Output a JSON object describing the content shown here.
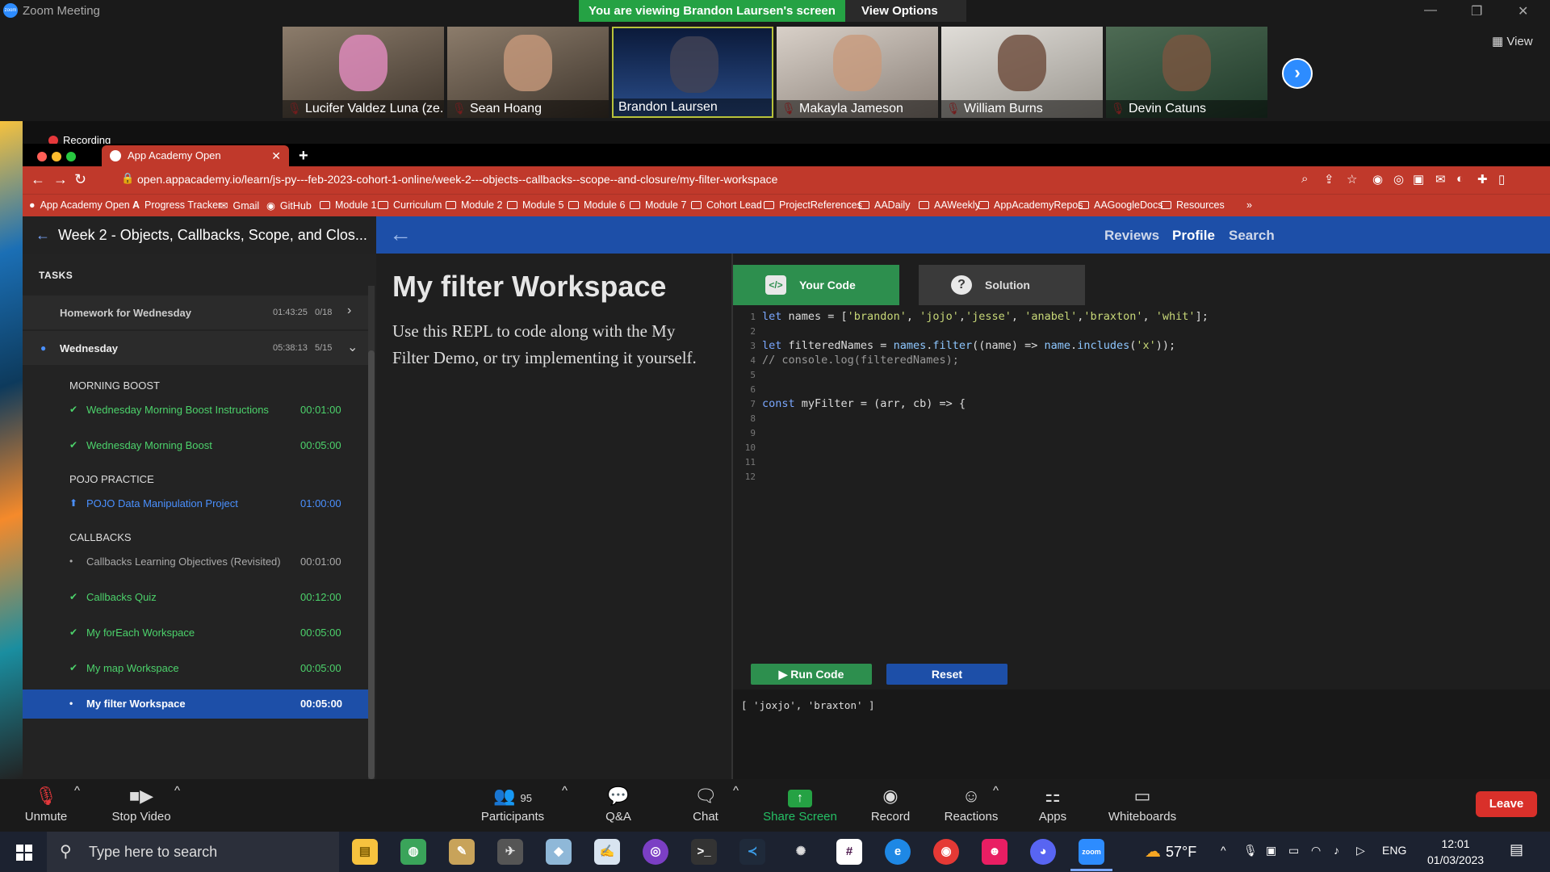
{
  "zoom": {
    "window_title": "Zoom Meeting",
    "share_banner": "You are viewing Brandon Laursen's screen",
    "view_options": "View Options",
    "view_button": "View",
    "recording": "Recording",
    "participants": [
      {
        "name": "Lucifer Valdez Luna (ze...",
        "muted": true
      },
      {
        "name": "Sean Hoang",
        "muted": true
      },
      {
        "name": "Brandon Laursen",
        "muted": false
      },
      {
        "name": "Makayla Jameson",
        "muted": true
      },
      {
        "name": "William Burns",
        "muted": true
      },
      {
        "name": "Devin Catuns",
        "muted": true
      }
    ],
    "toolbar": {
      "unmute": "Unmute",
      "stop_video": "Stop Video",
      "participants": "Participants",
      "participant_count": "95",
      "qa": "Q&A",
      "chat": "Chat",
      "share_screen": "Share Screen",
      "record": "Record",
      "reactions": "Reactions",
      "apps": "Apps",
      "whiteboards": "Whiteboards",
      "leave": "Leave"
    }
  },
  "browser": {
    "tab_title": "App Academy Open",
    "url": "open.appacademy.io/learn/js-py---feb-2023-cohort-1-online/week-2---objects--callbacks--scope--and-closure/my-filter-workspace",
    "bookmarks": [
      "App Academy Open",
      "Progress Tracker",
      "Gmail",
      "GitHub",
      "Module 1",
      "Curriculum",
      "Module 2",
      "Module 5",
      "Module 6",
      "Module 7",
      "Cohort Lead",
      "ProjectReferences",
      "AADaily",
      "AAWeekly",
      "AppAcademyRepos",
      "AAGoogleDocs",
      "Resources"
    ]
  },
  "app": {
    "week_title": "Week 2 - Objects, Callbacks, Scope, and Clos...",
    "nav": {
      "reviews": "Reviews",
      "profile": "Profile",
      "search": "Search"
    },
    "sidebar": {
      "heading": "TASKS",
      "group1": {
        "label": "Homework for Wednesday",
        "time": "01:43:25",
        "count": "0/18"
      },
      "group2": {
        "label": "Wednesday",
        "time": "05:38:13",
        "count": "5/15"
      },
      "sections": {
        "morning": "MORNING BOOST",
        "pojo": "POJO PRACTICE",
        "callbacks": "CALLBACKS"
      },
      "items": [
        {
          "label": "Wednesday Morning Boost Instructions",
          "time": "00:01:00"
        },
        {
          "label": "Wednesday Morning Boost",
          "time": "00:05:00"
        },
        {
          "label": "POJO Data Manipulation Project",
          "time": "01:00:00"
        },
        {
          "label": "Callbacks Learning Objectives (Revisited)",
          "time": "00:01:00"
        },
        {
          "label": "Callbacks Quiz",
          "time": "00:12:00"
        },
        {
          "label": "My forEach Workspace",
          "time": "00:05:00"
        },
        {
          "label": "My map Workspace",
          "time": "00:05:00"
        },
        {
          "label": "My filter Workspace",
          "time": "00:05:00"
        }
      ]
    },
    "content": {
      "title": "My filter Workspace",
      "description": "Use this REPL to code along with the My Filter Demo, or try implementing it yourself."
    },
    "editor": {
      "tab_your_code": "Your Code",
      "tab_solution": "Solution",
      "line_numbers": [
        "1",
        "2",
        "3",
        "4",
        "5",
        "6",
        "7",
        "8",
        "9",
        "10",
        "11",
        "12"
      ],
      "run": "Run Code",
      "reset": "Reset",
      "output": "[ 'joxjo', 'braxton' ]"
    }
  },
  "taskbar": {
    "search_placeholder": "Type here to search",
    "weather": "57°F",
    "language": "ENG",
    "time": "12:01",
    "date": "01/03/2023"
  }
}
